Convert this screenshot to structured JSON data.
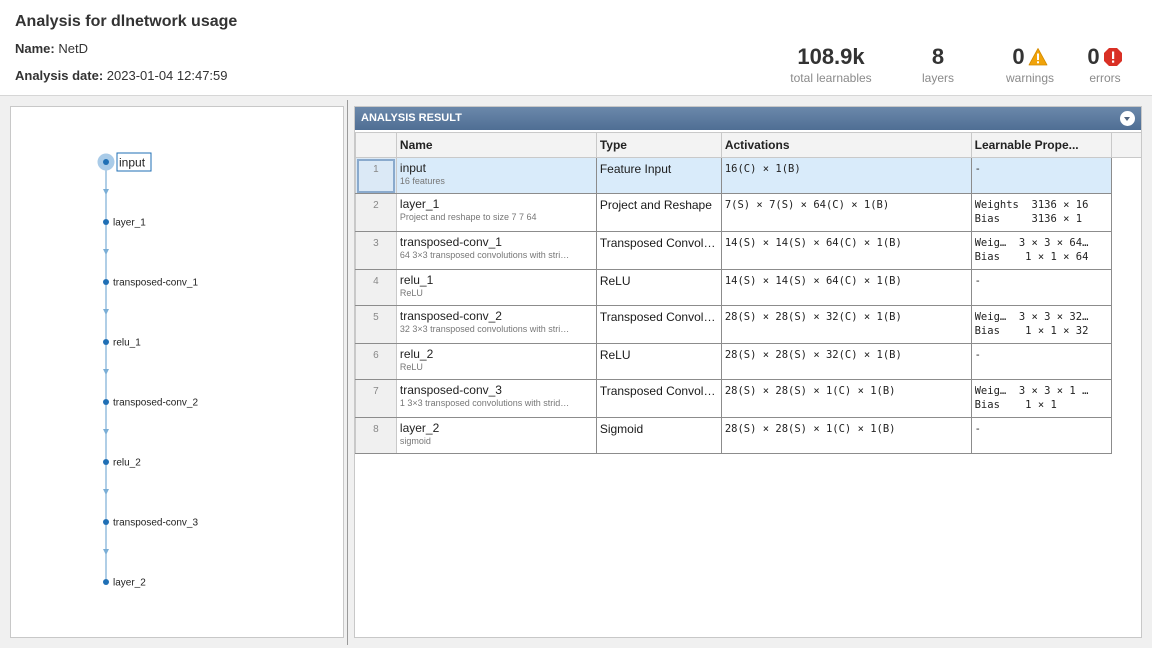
{
  "header": {
    "title": "Analysis for dlnetwork usage",
    "name_label": "Name:",
    "name_value": "NetD",
    "date_label": "Analysis date:",
    "date_value": "2023-01-04 12:47:59"
  },
  "stats": {
    "learnables": {
      "value": "108.9k",
      "label": "total learnables"
    },
    "layers": {
      "value": "8",
      "label": "layers"
    },
    "warnings": {
      "value": "0",
      "label": "warnings",
      "icon": "warning-triangle-icon",
      "color": "#f0a30a"
    },
    "errors": {
      "value": "0",
      "label": "errors",
      "icon": "error-octagon-icon",
      "color": "#d93025"
    }
  },
  "graph": {
    "nodes": [
      "input",
      "layer_1",
      "transposed-conv_1",
      "relu_1",
      "transposed-conv_2",
      "relu_2",
      "transposed-conv_3",
      "layer_2"
    ],
    "selected": "input",
    "node_color": "#1f6fb5",
    "edge_color": "#7aaed6"
  },
  "result": {
    "title": "ANALYSIS RESULT",
    "columns": [
      "Name",
      "Type",
      "Activations",
      "Learnable Prope..."
    ],
    "rows": [
      {
        "index": "1",
        "name": "input",
        "desc": "16 features",
        "type": "Feature Input",
        "act": "16(C) × 1(B)",
        "learn1": "-",
        "learn2": ""
      },
      {
        "index": "2",
        "name": "layer_1",
        "desc": "Project and reshape to size 7 7 64",
        "type": "Project and Reshape",
        "act": "7(S) × 7(S) × 64(C) × 1(B)",
        "learn1": "Weights  3136 × 16",
        "learn2": "Bias     3136 × 1"
      },
      {
        "index": "3",
        "name": "transposed-conv_1",
        "desc": "64 3×3 transposed convolutions with stri…",
        "type": "Transposed Convol…",
        "act": "14(S) × 14(S) × 64(C) × 1(B)",
        "learn1": "Weig…  3 × 3 × 64…",
        "learn2": "Bias    1 × 1 × 64"
      },
      {
        "index": "4",
        "name": "relu_1",
        "desc": "ReLU",
        "type": "ReLU",
        "act": "14(S) × 14(S) × 64(C) × 1(B)",
        "learn1": "-",
        "learn2": ""
      },
      {
        "index": "5",
        "name": "transposed-conv_2",
        "desc": "32 3×3 transposed convolutions with stri…",
        "type": "Transposed Convol…",
        "act": "28(S) × 28(S) × 32(C) × 1(B)",
        "learn1": "Weig…  3 × 3 × 32…",
        "learn2": "Bias    1 × 1 × 32"
      },
      {
        "index": "6",
        "name": "relu_2",
        "desc": "ReLU",
        "type": "ReLU",
        "act": "28(S) × 28(S) × 32(C) × 1(B)",
        "learn1": "-",
        "learn2": ""
      },
      {
        "index": "7",
        "name": "transposed-conv_3",
        "desc": "1 3×3 transposed convolutions with strid…",
        "type": "Transposed Convol…",
        "act": "28(S) × 28(S) × 1(C) × 1(B)",
        "learn1": "Weig…  3 × 3 × 1 …",
        "learn2": "Bias    1 × 1"
      },
      {
        "index": "8",
        "name": "layer_2",
        "desc": "sigmoid",
        "type": "Sigmoid",
        "act": "28(S) × 28(S) × 1(C) × 1(B)",
        "learn1": "-",
        "learn2": ""
      }
    ]
  }
}
